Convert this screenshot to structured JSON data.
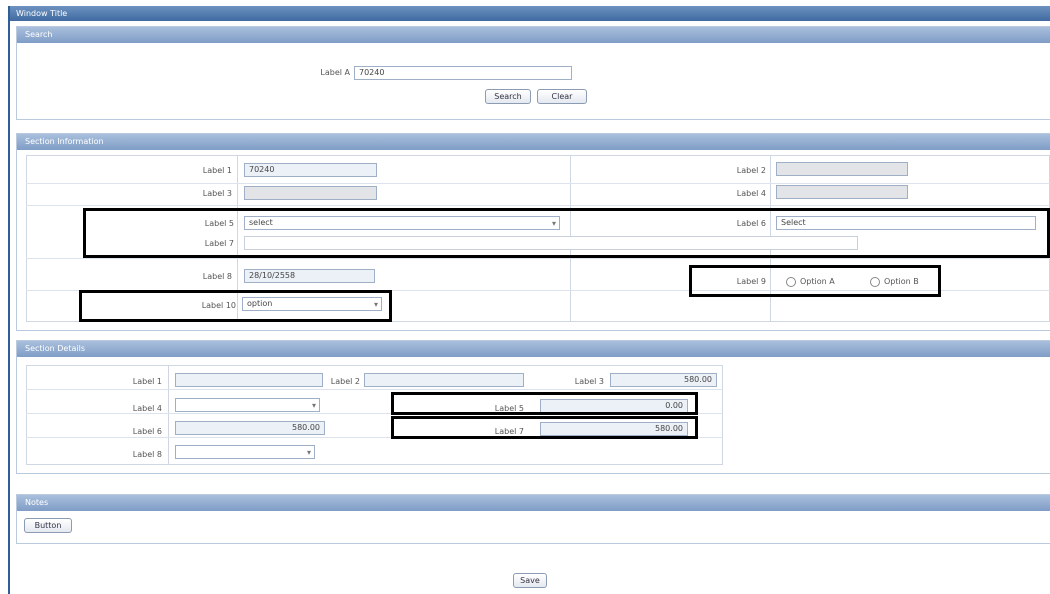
{
  "window": {
    "title": "Window Title"
  },
  "search": {
    "title": "Search",
    "field_label": "Label A",
    "field_value": "70240",
    "search_button": "Search",
    "clear_button": "Clear"
  },
  "info": {
    "title": "Section Information",
    "labels": [
      "Label 1",
      "Label 2",
      "Label 3",
      "Label 4",
      "Label 5",
      "Label 6",
      "Label 7",
      "Label 8",
      "Label 9",
      "Label 10"
    ],
    "code_value": "70240",
    "select_value": "select",
    "text_value": "",
    "date_value": "28/10/2558",
    "right_select_value": "Select",
    "option_value": "option",
    "radio_a": "Option A",
    "radio_b": "Option B"
  },
  "detail": {
    "title": "Section Details",
    "labels": [
      "Label 1",
      "Label 2",
      "Label 3",
      "Label 4",
      "Label 5",
      "Label 6",
      "Label 7",
      "Label 8"
    ],
    "code_value": "",
    "date_value": "",
    "amount_value": "580.00",
    "type_select": "",
    "amount2_value": "580.00",
    "status_select": "",
    "value_zero": "0.00",
    "value_total": "580.00"
  },
  "notes": {
    "title": "Notes",
    "button": "Button"
  },
  "footer": {
    "save_button": "Save"
  }
}
